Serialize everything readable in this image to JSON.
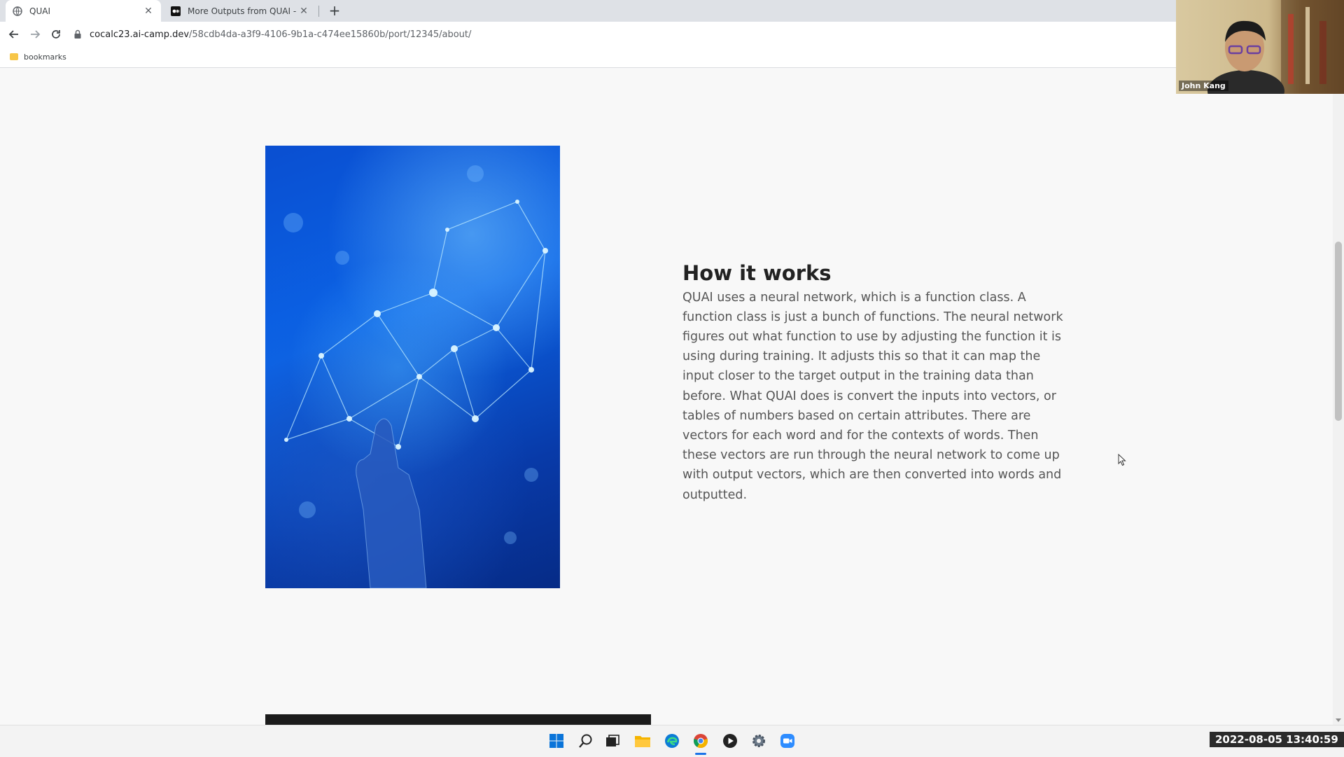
{
  "browser": {
    "tabs": [
      {
        "title": "QUAI",
        "active": true
      },
      {
        "title": "More Outputs from QUAI - QU",
        "active": false
      }
    ],
    "url_host": "cocalc23.ai-camp.dev",
    "url_path": "/58cdb4da-a3f9-4106-9b1a-c474ee15860b/port/12345/about/",
    "bookmarks": [
      {
        "label": "bookmarks"
      }
    ]
  },
  "content": {
    "heading": "How it works",
    "body": "QUAI uses a neural network, which is a function class. A function class is just a bunch of functions. The neural network figures out what function to use by adjusting the function it is using during training. It adjusts this so that it can map the input closer to the target output in the training data than before. What QUAI does is convert the inputs into vectors, or tables of numbers based on certain attributes. There are vectors for each word and for the contexts of words. Then these vectors are run through the neural network to come up with output vectors, which are then converted into words and outputted."
  },
  "webcam": {
    "name": "John Kang"
  },
  "taskbar": {
    "icons": [
      "windows-start",
      "search",
      "task-view",
      "file-explorer",
      "edge",
      "chrome",
      "media-player",
      "settings",
      "zoom"
    ],
    "timestamp": "2022-08-05  13:40:59"
  },
  "colors": {
    "accent": "#1a73e8",
    "heading": "#222222",
    "body": "#555555",
    "image": "#0b63e6"
  }
}
